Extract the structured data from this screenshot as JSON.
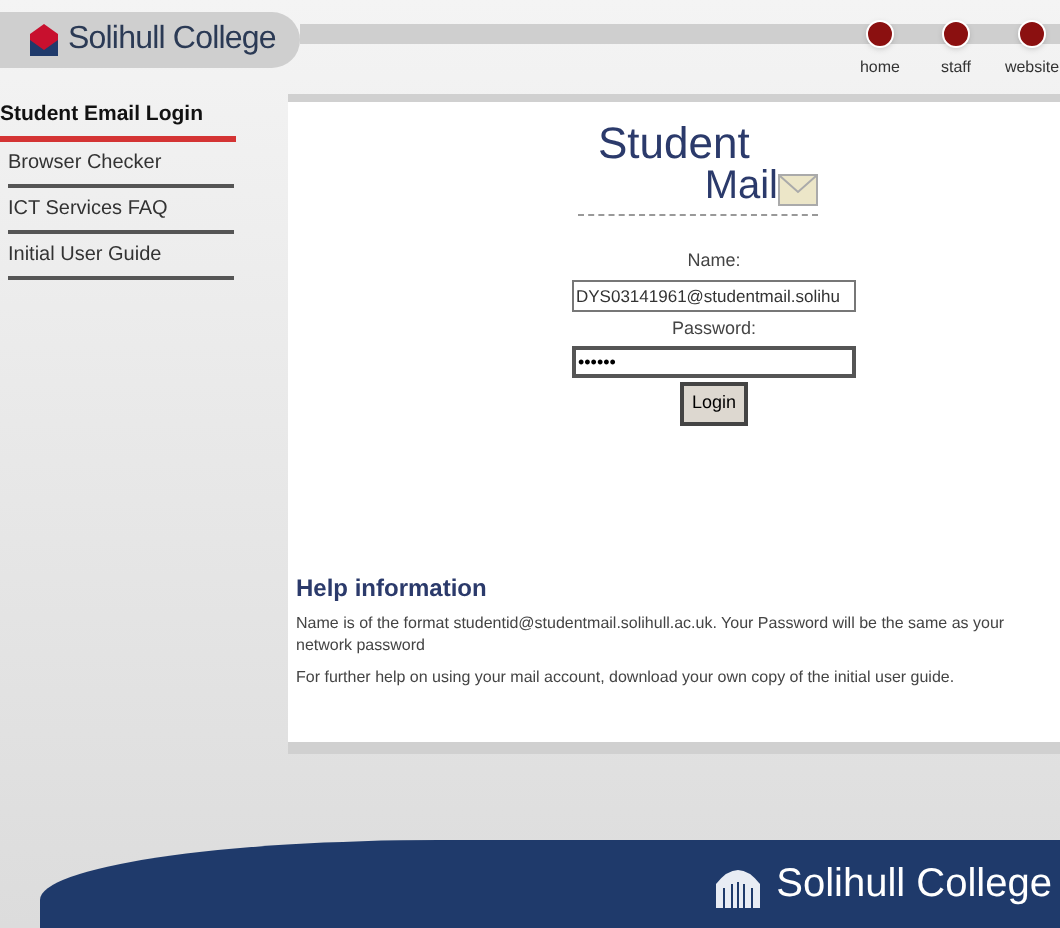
{
  "header": {
    "brand": "Solihull College",
    "nav": [
      {
        "label": "home"
      },
      {
        "label": "staff"
      },
      {
        "label": "website"
      }
    ]
  },
  "sidebar": {
    "heading": "Student Email Login",
    "items": [
      {
        "label": "Browser Checker"
      },
      {
        "label": "ICT Services FAQ"
      },
      {
        "label": "Initial User Guide"
      }
    ]
  },
  "logo": {
    "line1": "Student",
    "line2": "Mail"
  },
  "form": {
    "name_label": "Name:",
    "name_value": "DYS03141961@studentmail.solihu",
    "password_label": "Password:",
    "password_value": "••••••",
    "button": "Login"
  },
  "help": {
    "title": "Help information",
    "paragraphs": [
      "Name is of the format studentid@studentmail.solihull.ac.uk. Your Password will be the same as your network password",
      "For further help on using your mail account, download your own copy of the initial user guide."
    ]
  },
  "footer": {
    "brand": "Solihull College"
  }
}
